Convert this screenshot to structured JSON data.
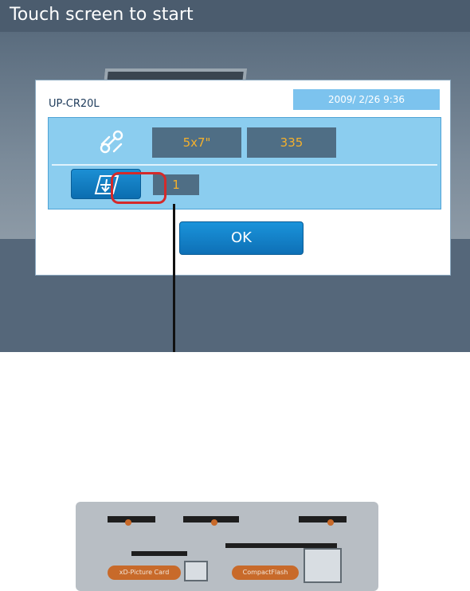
{
  "header": {
    "title": "Touch screen to start"
  },
  "background": {
    "cards": [
      "xD-Picture Card",
      "CompactFlash"
    ]
  },
  "dialog": {
    "model": "UP-CR20L",
    "datetime": "2009/ 2/26  9:36",
    "print_size": "5x7\"",
    "remaining": "335",
    "copies": "1",
    "ok_label": "OK"
  },
  "colors": {
    "dialog_panel": "#8bcdef",
    "value_box": "#4f6e85",
    "value_text": "#f4b02c",
    "button_blue": "#1a93da",
    "highlight_red": "#d42a2a"
  },
  "icons": {
    "link": "link-icon",
    "copies": "copies-icon"
  }
}
